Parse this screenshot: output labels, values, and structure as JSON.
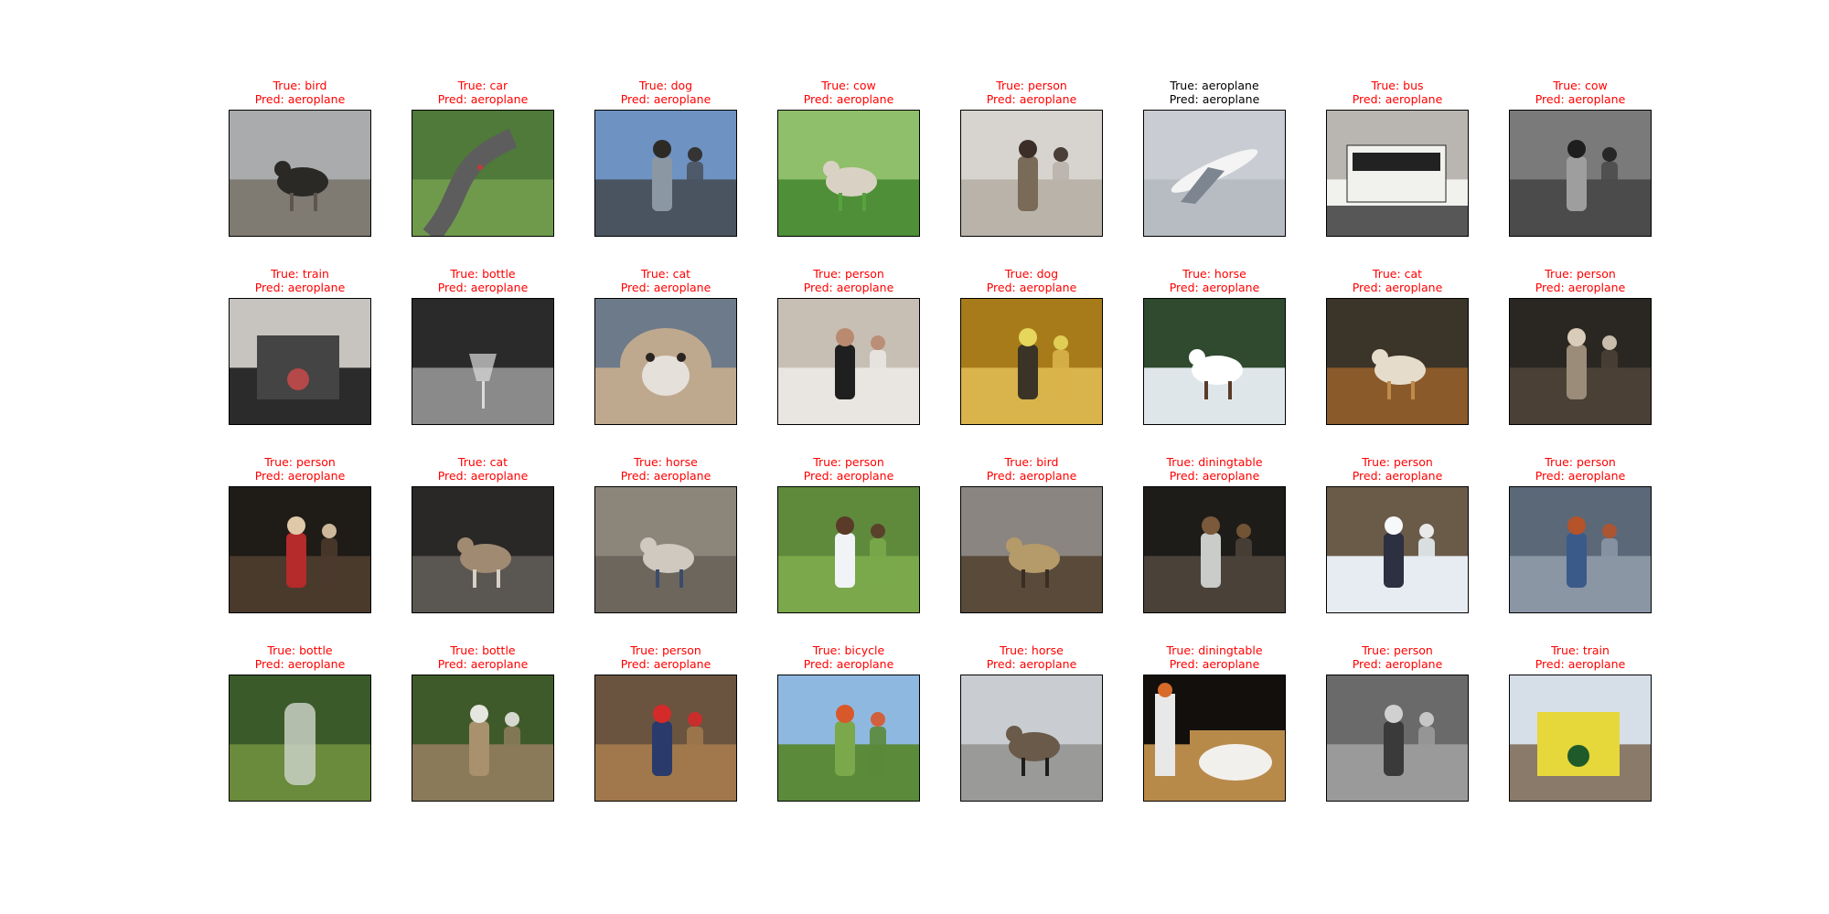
{
  "figure": {
    "true_prefix": "True: ",
    "pred_prefix": "Pred: ",
    "colors": {
      "mismatch": "#ff0000",
      "match": "#000000",
      "frame": "#000000"
    }
  },
  "cells": [
    {
      "true": "bird",
      "pred": "aeroplane",
      "scene": {
        "bg": "#a9abac",
        "mid": "#7f7a72",
        "fg": "#5c564e",
        "accent": "#2a2926",
        "subject": "bird"
      }
    },
    {
      "true": "car",
      "pred": "aeroplane",
      "scene": {
        "bg": "#4f7a3a",
        "mid": "#6f9a4c",
        "fg": "#5d5d5d",
        "accent": "#c03a3a",
        "subject": "track"
      }
    },
    {
      "true": "dog",
      "pred": "aeroplane",
      "scene": {
        "bg": "#6e92c2",
        "mid": "#4a5460",
        "fg": "#8c97a4",
        "accent": "#2d2a26",
        "subject": "car-window"
      }
    },
    {
      "true": "cow",
      "pred": "aeroplane",
      "scene": {
        "bg": "#8fbf6a",
        "mid": "#4f8f38",
        "fg": "#58a23e",
        "accent": "#d9d2c4",
        "subject": "cow"
      }
    },
    {
      "true": "person",
      "pred": "aeroplane",
      "scene": {
        "bg": "#d7d4cf",
        "mid": "#b9b3aa",
        "fg": "#7a6a58",
        "accent": "#3b2e28",
        "subject": "room"
      }
    },
    {
      "true": "aeroplane",
      "pred": "aeroplane",
      "scene": {
        "bg": "#c9cdd3",
        "mid": "#b7bcc2",
        "fg": "#f4f4f4",
        "accent": "#7d8590",
        "subject": "plane"
      }
    },
    {
      "true": "bus",
      "pred": "aeroplane",
      "scene": {
        "bg": "#b9b6b1",
        "mid": "#f1f1ee",
        "fg": "#575757",
        "accent": "#222222",
        "subject": "bus"
      }
    },
    {
      "true": "cow",
      "pred": "aeroplane",
      "scene": {
        "bg": "#7a7a7a",
        "mid": "#4b4b4b",
        "fg": "#9e9e9e",
        "accent": "#1e1e1e",
        "subject": "bw-street"
      }
    },
    {
      "true": "train",
      "pred": "aeroplane",
      "scene": {
        "bg": "#c7c4c0",
        "mid": "#2b2b2b",
        "fg": "#444444",
        "accent": "#b54848",
        "subject": "train"
      }
    },
    {
      "true": "bottle",
      "pred": "aeroplane",
      "scene": {
        "bg": "#2a2a2a",
        "mid": "#8a8a8a",
        "fg": "#1a1a1a",
        "accent": "#dcdcdc",
        "subject": "glass"
      }
    },
    {
      "true": "cat",
      "pred": "aeroplane",
      "scene": {
        "bg": "#6d7a8a",
        "mid": "#bfa98e",
        "fg": "#e6e0da",
        "accent": "#2a2522",
        "subject": "cat-face"
      }
    },
    {
      "true": "person",
      "pred": "aeroplane",
      "scene": {
        "bg": "#c8bfb4",
        "mid": "#e9e6e1",
        "fg": "#1f1f1f",
        "accent": "#b98a70",
        "subject": "two-people"
      }
    },
    {
      "true": "dog",
      "pred": "aeroplane",
      "scene": {
        "bg": "#a77b1a",
        "mid": "#d9b34b",
        "fg": "#3a3326",
        "accent": "#e6d65c",
        "subject": "van"
      }
    },
    {
      "true": "horse",
      "pred": "aeroplane",
      "scene": {
        "bg": "#2f4a2f",
        "mid": "#dfe6ea",
        "fg": "#5a3a28",
        "accent": "#ffffff",
        "subject": "horse"
      }
    },
    {
      "true": "cat",
      "pred": "aeroplane",
      "scene": {
        "bg": "#3b3429",
        "mid": "#8a5a2a",
        "fg": "#c08a4c",
        "accent": "#e6dccc",
        "subject": "floor-cat"
      }
    },
    {
      "true": "person",
      "pred": "aeroplane",
      "scene": {
        "bg": "#2a2722",
        "mid": "#4a4036",
        "fg": "#9a8c78",
        "accent": "#d9cdb9",
        "subject": "kneel"
      }
    },
    {
      "true": "person",
      "pred": "aeroplane",
      "scene": {
        "bg": "#1f1b17",
        "mid": "#4a3a2c",
        "fg": "#b52a2a",
        "accent": "#e0c9a8",
        "subject": "motorbike"
      }
    },
    {
      "true": "cat",
      "pred": "aeroplane",
      "scene": {
        "bg": "#2a2826",
        "mid": "#5a5652",
        "fg": "#d8d0c6",
        "accent": "#a08a72",
        "subject": "lap-cat"
      }
    },
    {
      "true": "horse",
      "pred": "aeroplane",
      "scene": {
        "bg": "#8c857a",
        "mid": "#6d665c",
        "fg": "#3b4b6a",
        "accent": "#cfc9c0",
        "subject": "pony"
      }
    },
    {
      "true": "person",
      "pred": "aeroplane",
      "scene": {
        "bg": "#5f8a3c",
        "mid": "#7aa84a",
        "fg": "#f0f4f6",
        "accent": "#5a3a28",
        "subject": "woman"
      }
    },
    {
      "true": "bird",
      "pred": "aeroplane",
      "scene": {
        "bg": "#8a8580",
        "mid": "#5a4a3a",
        "fg": "#3a2e24",
        "accent": "#b59a6a",
        "subject": "tree-bird"
      }
    },
    {
      "true": "diningtable",
      "pred": "aeroplane",
      "scene": {
        "bg": "#1e1c19",
        "mid": "#4a4239",
        "fg": "#c9ccc8",
        "accent": "#7a5a3a",
        "subject": "dining"
      }
    },
    {
      "true": "person",
      "pred": "aeroplane",
      "scene": {
        "bg": "#6a5a48",
        "mid": "#e6ecf2",
        "fg": "#2c3040",
        "accent": "#f6f8fa",
        "subject": "snow"
      }
    },
    {
      "true": "person",
      "pred": "aeroplane",
      "scene": {
        "bg": "#5a6878",
        "mid": "#8a96a4",
        "fg": "#3a5a8a",
        "accent": "#b5532a",
        "subject": "portrait"
      }
    },
    {
      "true": "bottle",
      "pred": "aeroplane",
      "scene": {
        "bg": "#3a5a2a",
        "mid": "#6a8a3c",
        "fg": "#c9d0c4",
        "accent": "#8a7a5a",
        "subject": "plastic-bottle"
      }
    },
    {
      "true": "bottle",
      "pred": "aeroplane",
      "scene": {
        "bg": "#3f5a2a",
        "mid": "#8a7a5a",
        "fg": "#a8916c",
        "accent": "#e6e6e0",
        "subject": "yard"
      }
    },
    {
      "true": "person",
      "pred": "aeroplane",
      "scene": {
        "bg": "#6a5440",
        "mid": "#a0784c",
        "fg": "#2a3a6a",
        "accent": "#d42a2a",
        "subject": "toddler"
      }
    },
    {
      "true": "bicycle",
      "pred": "aeroplane",
      "scene": {
        "bg": "#8fb8e0",
        "mid": "#5a8a3a",
        "fg": "#7aa84a",
        "accent": "#d8582a",
        "subject": "cyclist"
      }
    },
    {
      "true": "horse",
      "pred": "aeroplane",
      "scene": {
        "bg": "#c9cdd2",
        "mid": "#9a9a98",
        "fg": "#1e1e1e",
        "accent": "#6a5a4a",
        "subject": "black-horses"
      }
    },
    {
      "true": "diningtable",
      "pred": "aeroplane",
      "scene": {
        "bg": "#120f0c",
        "mid": "#b88a4a",
        "fg": "#f2f0ec",
        "accent": "#d86a2a",
        "subject": "food"
      }
    },
    {
      "true": "person",
      "pred": "aeroplane",
      "scene": {
        "bg": "#6a6a6a",
        "mid": "#9a9a9a",
        "fg": "#3a3a3a",
        "accent": "#d0d0d0",
        "subject": "bw-court"
      }
    },
    {
      "true": "train",
      "pred": "aeroplane",
      "scene": {
        "bg": "#d6dfe8",
        "mid": "#8a7a6a",
        "fg": "#e6d83a",
        "accent": "#1f5a2a",
        "subject": "yellow-train"
      }
    }
  ]
}
